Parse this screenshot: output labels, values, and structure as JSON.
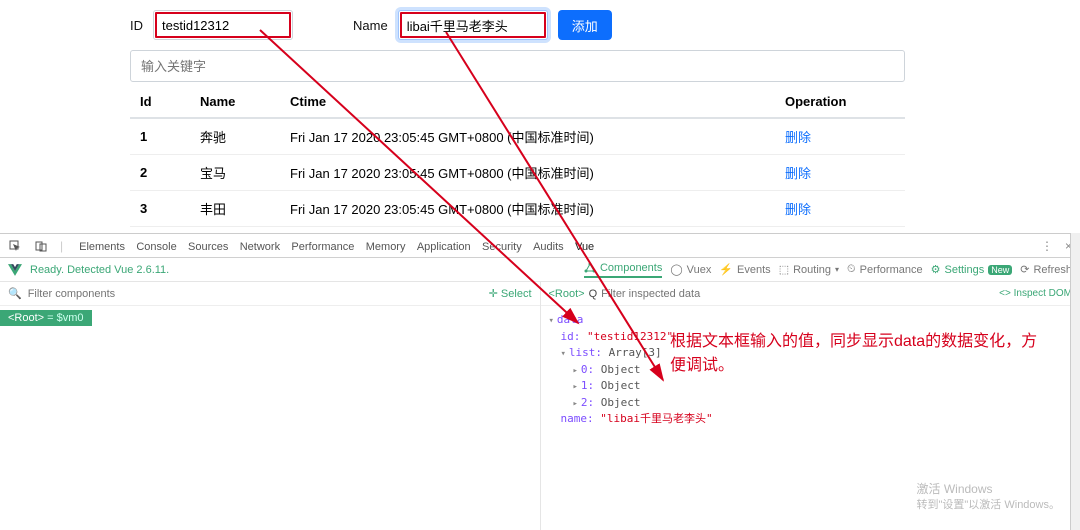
{
  "form": {
    "id_label": "ID",
    "id_value": "testid12312",
    "name_label": "Name",
    "name_value": "libai千里马老李头",
    "add_button": "添加",
    "search_placeholder": "输入关键字"
  },
  "table": {
    "headers": {
      "id": "Id",
      "name": "Name",
      "ctime": "Ctime",
      "operation": "Operation"
    },
    "delete_label": "删除",
    "rows": [
      {
        "id": "1",
        "name": "奔驰",
        "ctime": "Fri Jan 17 2020 23:05:45 GMT+0800 (中国标准时间)"
      },
      {
        "id": "2",
        "name": "宝马",
        "ctime": "Fri Jan 17 2020 23:05:45 GMT+0800 (中国标准时间)"
      },
      {
        "id": "3",
        "name": "丰田",
        "ctime": "Fri Jan 17 2020 23:05:45 GMT+0800 (中国标准时间)"
      }
    ]
  },
  "devtools": {
    "tabs": [
      "Elements",
      "Console",
      "Sources",
      "Network",
      "Performance",
      "Memory",
      "Application",
      "Security",
      "Audits",
      "Vue"
    ],
    "status": "Ready. Detected Vue 2.6.11.",
    "subtabs": {
      "components": "Components",
      "vuex": "Vuex",
      "events": "Events",
      "routing": "Routing",
      "performance": "Performance",
      "settings": "Settings",
      "settings_badge": "New",
      "refresh": "Refresh"
    },
    "filter_placeholder": "Filter components",
    "select_label": "Select",
    "filter_inspected": "Filter inspected data",
    "inspect_dom": "Inspect DOM",
    "breadcrumb_root": "<Root>",
    "breadcrumb_var": "= $vm0",
    "bc_q": "Q",
    "data_label": "data",
    "data_id_key": "id:",
    "data_id_val": "\"testid12312\"",
    "data_list_key": "list:",
    "data_list_val": "Array[3]",
    "data_list_items": [
      "0: Object",
      "1: Object",
      "2: Object"
    ],
    "data_name_key": "name:",
    "data_name_val": "\"libai千里马老李头\""
  },
  "annotation": "根据文本框输入的值，同步显示data的数据变化，方便调试。",
  "watermark": {
    "title": "激活 Windows",
    "sub": "转到\"设置\"以激活 Windows。"
  }
}
